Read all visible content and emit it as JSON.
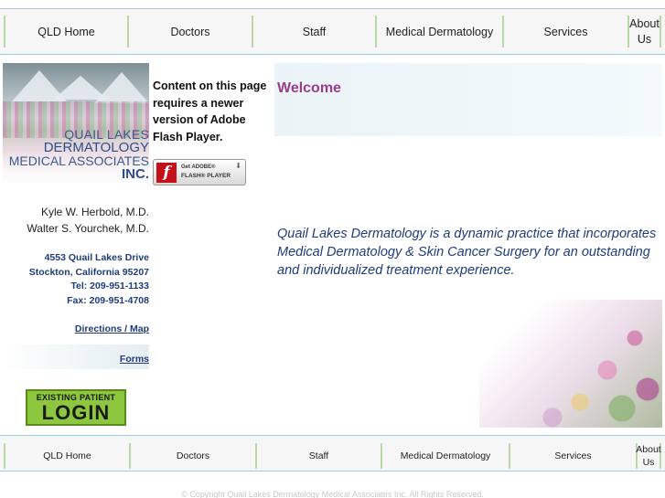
{
  "nav": {
    "items": [
      "QLD Home",
      "Doctors",
      "Staff",
      "Medical Dermatology",
      "Services",
      "About Us"
    ]
  },
  "sidebar": {
    "logo": {
      "line1": "QUAIL LAKES",
      "line2": "DERMATOLOGY",
      "line3": "MEDICAL ASSOCIATES",
      "line4": "INC."
    },
    "doctors": [
      "Kyle W. Herbold, M.D.",
      "Walter S. Yourchek, M.D."
    ],
    "address": {
      "street": "4553 Quail Lakes Drive",
      "city": "Stockton, California 95207",
      "tel": "Tel: 209-951-1133",
      "fax": "Fax: 209-951-4708"
    },
    "links": {
      "directions": "Directions / Map",
      "forms": "Forms"
    },
    "login": {
      "line1": "EXISTING PATIENT",
      "line2": "LOGIN"
    }
  },
  "flash": {
    "message": "Content on this page requires a newer version of Adobe Flash Player.",
    "badge_line1": "Get ADOBE®",
    "badge_line2": "FLASH® PLAYER"
  },
  "main": {
    "heading": "Welcome",
    "intro": "Quail Lakes Dermatology is a dynamic practice that incorporates Medical Dermatology & Skin Cancer Surgery for an outstanding and individualized treatment experience."
  },
  "footer": {
    "copyright": "© Copyright Quail Lakes Dermatology Medical Associates Inc.   All Rights Reserved."
  },
  "colors": {
    "nav_border": "#9bd0d8",
    "nav_divider": "#b8d8a8",
    "welcome": "#9b3d8f",
    "text_blue": "#1f3b7a",
    "login_green": "#8dc63f"
  }
}
